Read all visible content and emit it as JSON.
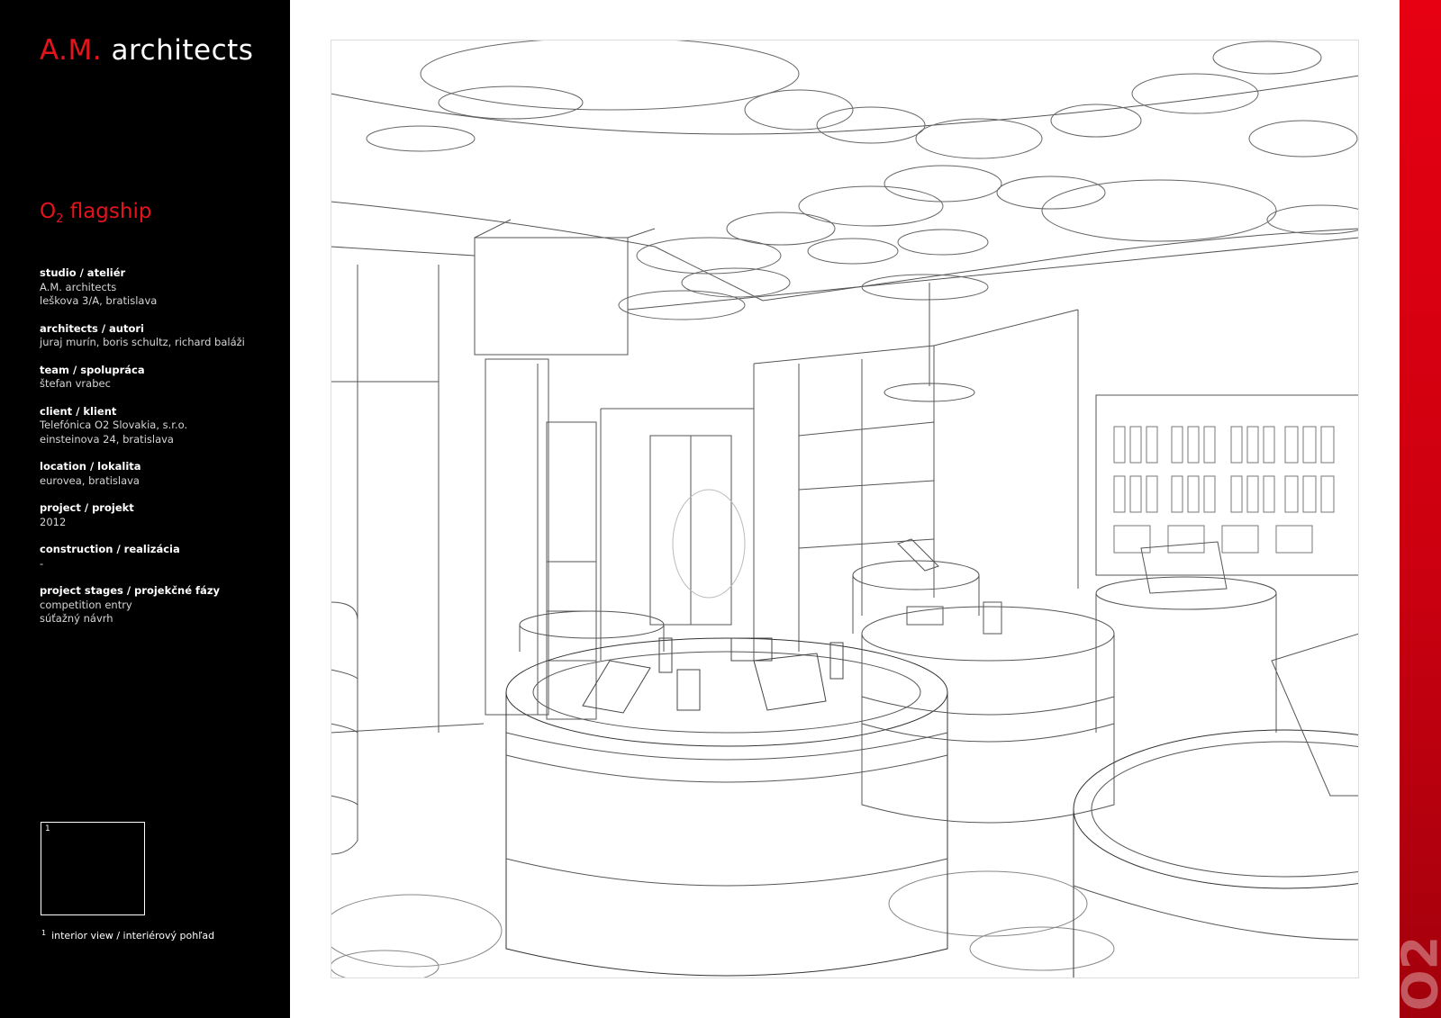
{
  "brand": {
    "initials": "A.M.",
    "name": "architects"
  },
  "project": {
    "title_main": "O",
    "title_sub": "2",
    "title_rest": " flagship"
  },
  "info": [
    {
      "label": "studio / ateliér",
      "lines": [
        "A.M. architects",
        "leškova 3/A, bratislava"
      ]
    },
    {
      "label": "architects / autori",
      "lines": [
        "juraj murín, boris schultz, richard baláži"
      ]
    },
    {
      "label": "team / spolupráca",
      "lines": [
        "štefan vrabec"
      ]
    },
    {
      "label": "client / klient",
      "lines": [
        "Telefónica O2 Slovakia, s.r.o.",
        "einsteinova 24, bratislava"
      ]
    },
    {
      "label": "location / lokalita",
      "lines": [
        "eurovea, bratislava"
      ]
    },
    {
      "label": "project / projekt",
      "lines": [
        "2012"
      ]
    },
    {
      "label": "construction / realizácia",
      "lines": [
        "-"
      ]
    },
    {
      "label": "project stages / projekčné fázy",
      "lines": [
        "competition entry",
        "súťažný návrh"
      ]
    }
  ],
  "thumbnail": {
    "number": "1"
  },
  "caption": {
    "number": "1",
    "text": "interior view / interiérový pohľad"
  },
  "redbar": {
    "text": "O2"
  },
  "colors": {
    "accent": "#e3141c",
    "sidebar": "#000000"
  }
}
